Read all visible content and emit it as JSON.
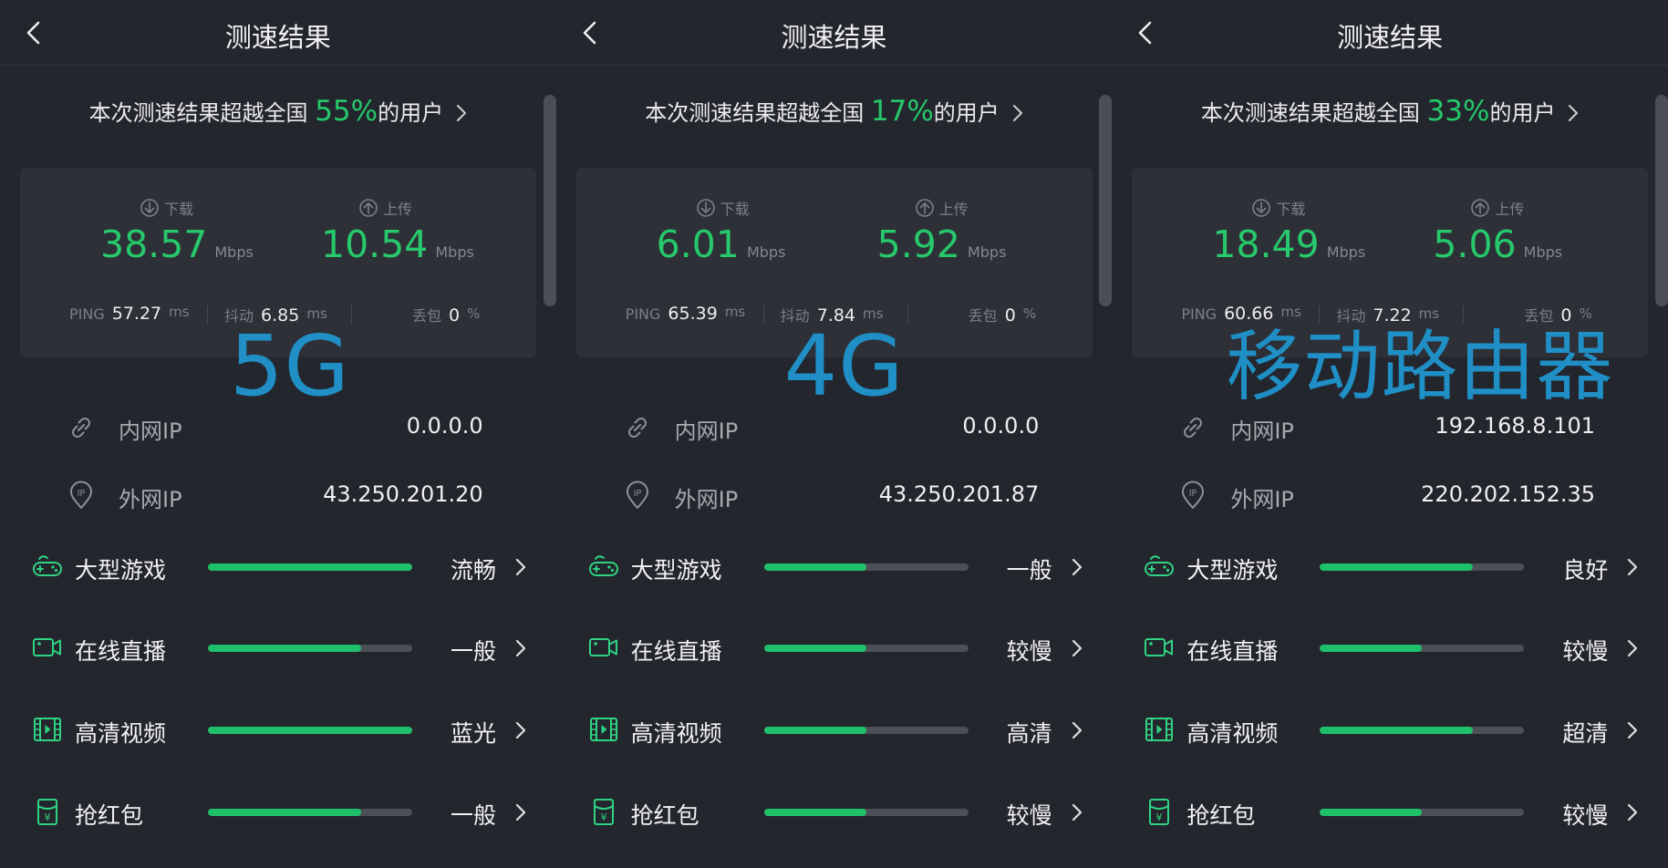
{
  "panels": [
    {
      "title": "测速结果",
      "rank": {
        "prefix": "本次测速结果超越全国 ",
        "percent": "55%",
        "suffix": "的用户"
      },
      "download": {
        "label": "下载",
        "value": "38.57",
        "unit": "Mbps"
      },
      "upload": {
        "label": "上传",
        "value": "10.54",
        "unit": "Mbps"
      },
      "ping": {
        "label": "PING",
        "value": "57.27",
        "unit": "ms"
      },
      "jitter": {
        "label": "抖动",
        "value": "6.85",
        "unit": "ms"
      },
      "loss": {
        "label": "丢包",
        "value": "0",
        "unit": "%"
      },
      "overlay": "5G",
      "lan_ip": {
        "label": "内网IP",
        "value": "0.0.0.0"
      },
      "wan_ip": {
        "label": "外网IP",
        "value": "43.250.201.20"
      },
      "quality": [
        {
          "label": "大型游戏",
          "status": "流畅",
          "level": 1.0,
          "icon": "gamepad-icon"
        },
        {
          "label": "在线直播",
          "status": "一般",
          "level": 0.75,
          "icon": "camera-icon"
        },
        {
          "label": "高清视频",
          "status": "蓝光",
          "level": 1.0,
          "icon": "film-icon"
        },
        {
          "label": "抢红包",
          "status": "一般",
          "level": 0.75,
          "icon": "red-packet-icon"
        }
      ]
    },
    {
      "title": "测速结果",
      "rank": {
        "prefix": "本次测速结果超越全国 ",
        "percent": "17%",
        "suffix": "的用户"
      },
      "download": {
        "label": "下载",
        "value": "6.01",
        "unit": "Mbps"
      },
      "upload": {
        "label": "上传",
        "value": "5.92",
        "unit": "Mbps"
      },
      "ping": {
        "label": "PING",
        "value": "65.39",
        "unit": "ms"
      },
      "jitter": {
        "label": "抖动",
        "value": "7.84",
        "unit": "ms"
      },
      "loss": {
        "label": "丢包",
        "value": "0",
        "unit": "%"
      },
      "overlay": "4G",
      "lan_ip": {
        "label": "内网IP",
        "value": "0.0.0.0"
      },
      "wan_ip": {
        "label": "外网IP",
        "value": "43.250.201.87"
      },
      "quality": [
        {
          "label": "大型游戏",
          "status": "一般",
          "level": 0.5,
          "icon": "gamepad-icon"
        },
        {
          "label": "在线直播",
          "status": "较慢",
          "level": 0.5,
          "icon": "camera-icon"
        },
        {
          "label": "高清视频",
          "status": "高清",
          "level": 0.5,
          "icon": "film-icon"
        },
        {
          "label": "抢红包",
          "status": "较慢",
          "level": 0.5,
          "icon": "red-packet-icon"
        }
      ]
    },
    {
      "title": "测速结果",
      "rank": {
        "prefix": "本次测速结果超越全国 ",
        "percent": "33%",
        "suffix": "的用户"
      },
      "download": {
        "label": "下载",
        "value": "18.49",
        "unit": "Mbps"
      },
      "upload": {
        "label": "上传",
        "value": "5.06",
        "unit": "Mbps"
      },
      "ping": {
        "label": "PING",
        "value": "60.66",
        "unit": "ms"
      },
      "jitter": {
        "label": "抖动",
        "value": "7.22",
        "unit": "ms"
      },
      "loss": {
        "label": "丢包",
        "value": "0",
        "unit": "%"
      },
      "overlay": "移动路由器",
      "lan_ip": {
        "label": "内网IP",
        "value": "192.168.8.101"
      },
      "wan_ip": {
        "label": "外网IP",
        "value": "220.202.152.35"
      },
      "quality": [
        {
          "label": "大型游戏",
          "status": "良好",
          "level": 0.75,
          "icon": "gamepad-icon"
        },
        {
          "label": "在线直播",
          "status": "较慢",
          "level": 0.5,
          "icon": "camera-icon"
        },
        {
          "label": "高清视频",
          "status": "超清",
          "level": 0.75,
          "icon": "film-icon"
        },
        {
          "label": "抢红包",
          "status": "较慢",
          "level": 0.5,
          "icon": "red-packet-icon"
        }
      ]
    }
  ],
  "colors": {
    "accent": "#27c96c",
    "overlay_text": "#1f8fc6",
    "background": "#23262d",
    "card": "#2d3037"
  }
}
